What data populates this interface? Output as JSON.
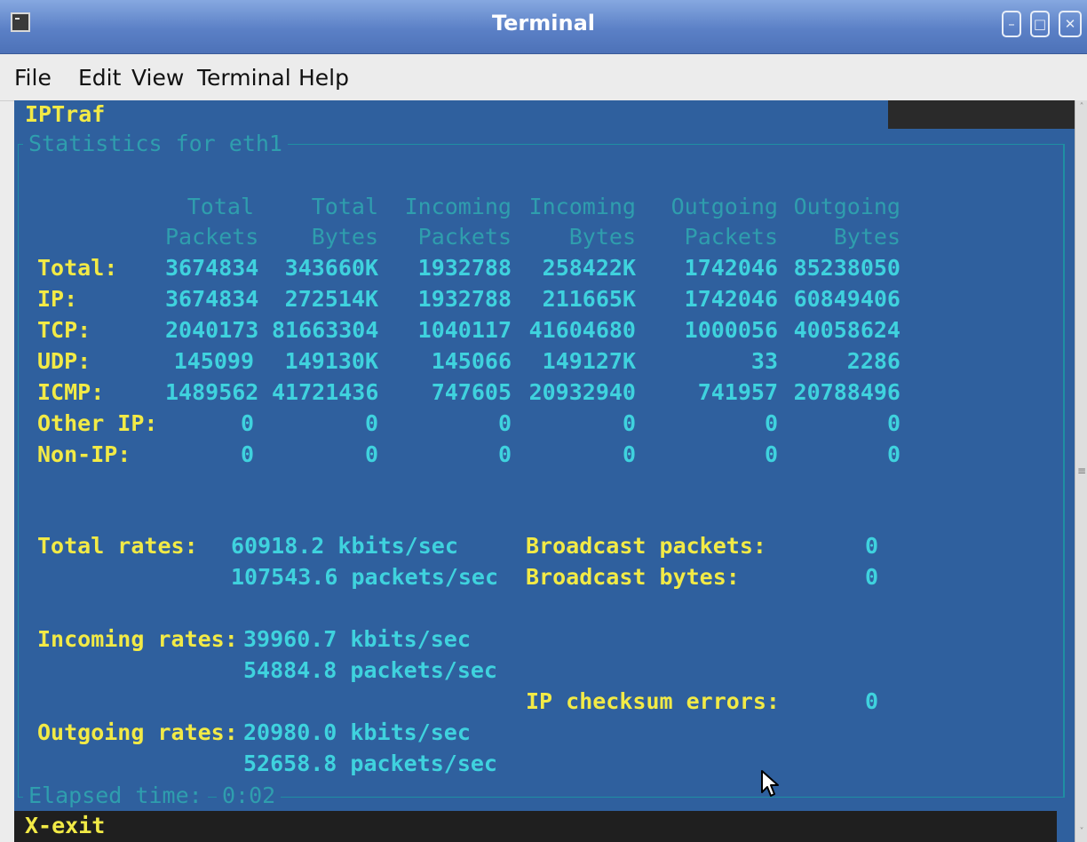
{
  "window": {
    "title": "Terminal"
  },
  "menu": [
    "File",
    "Edit",
    "View",
    "Terminal",
    "Help"
  ],
  "app": {
    "name": "IPTraf",
    "frame_title": "Statistics for eth1",
    "footer": "X-exit"
  },
  "headers": [
    [
      "Total",
      "Packets"
    ],
    [
      "Total",
      "Bytes"
    ],
    [
      "Incoming",
      "Packets"
    ],
    [
      "Incoming",
      "Bytes"
    ],
    [
      "Outgoing",
      "Packets"
    ],
    [
      "Outgoing",
      "Bytes"
    ]
  ],
  "rows": [
    {
      "label": "Total:",
      "values": [
        "3674834",
        "343660K",
        "1932788",
        "258422K",
        "1742046",
        "85238050"
      ]
    },
    {
      "label": "IP:",
      "values": [
        "3674834",
        "272514K",
        "1932788",
        "211665K",
        "1742046",
        "60849406"
      ]
    },
    {
      "label": "TCP:",
      "values": [
        "2040173",
        "81663304",
        "1040117",
        "41604680",
        "1000056",
        "40058624"
      ]
    },
    {
      "label": "UDP:",
      "values": [
        "145099",
        "149130K",
        "145066",
        "149127K",
        "33",
        "2286"
      ]
    },
    {
      "label": "ICMP:",
      "values": [
        "1489562",
        "41721436",
        "747605",
        "20932940",
        "741957",
        "20788496"
      ]
    },
    {
      "label": "Other IP:",
      "values": [
        "0",
        "0",
        "0",
        "0",
        "0",
        "0"
      ]
    },
    {
      "label": "Non-IP:",
      "values": [
        "0",
        "0",
        "0",
        "0",
        "0",
        "0"
      ]
    }
  ],
  "rates": {
    "total": {
      "label": "Total rates:",
      "kbits": "60918.2 kbits/sec",
      "packets": "107543.6 packets/sec"
    },
    "incoming": {
      "label": "Incoming rates:",
      "kbits": "39960.7 kbits/sec",
      "packets": "54884.8 packets/sec"
    },
    "outgoing": {
      "label": "Outgoing rates:",
      "kbits": "20980.0 kbits/sec",
      "packets": "52658.8 packets/sec"
    }
  },
  "broadcast": {
    "packets_label": "Broadcast packets:",
    "packets_value": "0",
    "bytes_label": "Broadcast bytes:",
    "bytes_value": "0"
  },
  "checksum": {
    "label": "IP checksum errors:",
    "value": "0"
  },
  "elapsed": {
    "label": "Elapsed time:",
    "value": "0:02"
  }
}
